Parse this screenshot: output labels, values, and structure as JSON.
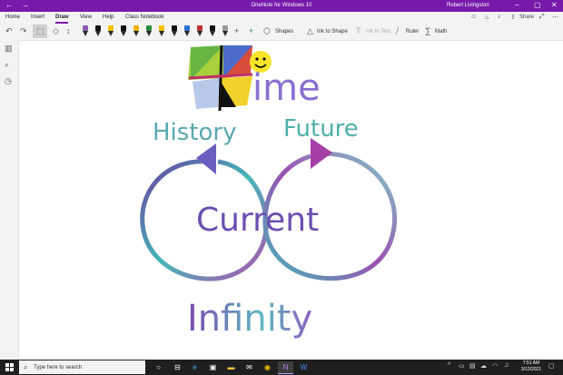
{
  "window": {
    "title": "OneNote for Windows 10",
    "user": "Robert Livingston",
    "back_glyph": "←",
    "forward_glyph": "→",
    "minimize_glyph": "–",
    "maximize_glyph": "▢",
    "close_glyph": "✕",
    "accent": "#7719aa"
  },
  "tabs": [
    {
      "label": "Home"
    },
    {
      "label": "Insert"
    },
    {
      "label": "Draw",
      "active": true
    },
    {
      "label": "View"
    },
    {
      "label": "Help"
    },
    {
      "label": "Class Notebook"
    }
  ],
  "tabs_right": {
    "share": "Share",
    "icons": [
      "people-icon",
      "lightbulb-icon",
      "bell-icon",
      "share-icon",
      "expand-icon",
      "more-icon"
    ]
  },
  "ribbon": {
    "undo_glyph": "↶",
    "redo_glyph": "↷",
    "lasso_glyph": "⬚",
    "eraser_glyph": "◇",
    "space_glyph": "↕",
    "add_pen_glyph": "+",
    "shapes": "Shapes",
    "ink_to_shape": "Ink to Shape",
    "ink_to_text": "Ink to Text",
    "ruler": "Ruler",
    "math": "Math",
    "pens": [
      {
        "tip": "#8a5bb0"
      },
      {
        "tip": "#111111"
      },
      {
        "tip": "#f2c200"
      },
      {
        "tip": "#111111"
      },
      {
        "tip": "#e8b300"
      },
      {
        "tip": "#2a8a3a"
      },
      {
        "tip": "#f2c200"
      },
      {
        "tip": "#111111"
      },
      {
        "tip": "#2b6fd6"
      },
      {
        "tip": "#c03030"
      },
      {
        "tip": "#111111"
      },
      {
        "tip": "#999999"
      }
    ]
  },
  "sidebar": {
    "icons": [
      "notebooks-icon",
      "search-icon",
      "recent-icon"
    ],
    "glyphs": [
      "▥",
      "⌕",
      "◷"
    ]
  },
  "drawing": {
    "letters_ime": "ime",
    "history": "History",
    "future": "Future",
    "current": "Current",
    "infinity": "Infinity",
    "ink_colors": [
      "#6b3fa0",
      "#44b8b8",
      "#b14fb0",
      "#7fd0c8"
    ]
  },
  "taskbar": {
    "search_placeholder": "Type here to search",
    "time": "7:51 AM",
    "date": "3/12/2021",
    "apps": [
      "task-view",
      "edge",
      "store",
      "file-explorer",
      "chrome",
      "onenote",
      "word"
    ]
  }
}
